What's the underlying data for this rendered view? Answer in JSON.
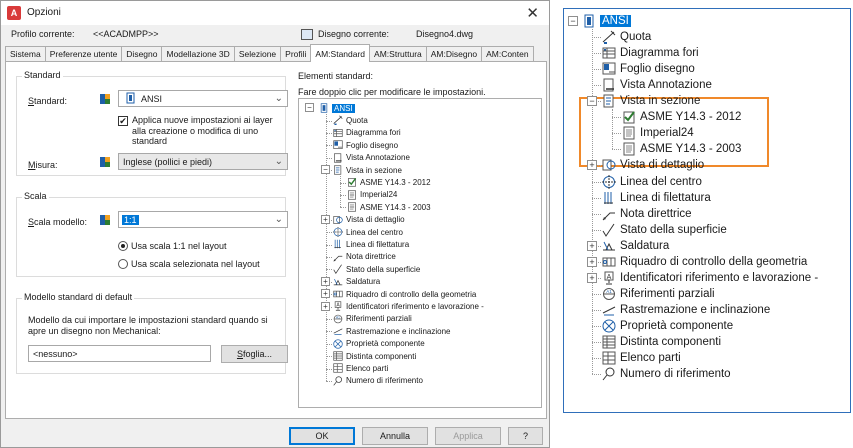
{
  "window": {
    "title": "Opzioni",
    "close_glyph": "✕"
  },
  "profile": {
    "current_label": "Profilo corrente:",
    "current_value": "<<ACADMPP>>",
    "drawing_label": "Disegno corrente:",
    "drawing_value": "Disegno4.dwg"
  },
  "tabs": [
    "Sistema",
    "Preferenze utente",
    "Disegno",
    "Modellazione 3D",
    "Selezione",
    "Profili",
    "AM:Standard",
    "AM:Struttura",
    "AM:Disegno",
    "AM:Conten"
  ],
  "active_tab": "AM:Standard",
  "standard_group": {
    "title": "Standard",
    "standard_label": "Standard:",
    "standard_value": "ANSI",
    "apply_checkbox_label": "Applica nuove impostazioni ai layer alla creazione o modifica di uno standard",
    "apply_checked": true,
    "units_label": "Misura:",
    "units_value": "Inglese (pollici e piedi)"
  },
  "scale_group": {
    "title": "Scala",
    "model_scale_label": "Scala modello:",
    "model_scale_value": "1:1",
    "radio_layout": "Usa scala 1:1 nel layout",
    "radio_selected": "Usa scala selezionata nel layout",
    "radio_checked_index": 0
  },
  "default_group": {
    "title": "Modello standard di default",
    "description": "Modello da cui importare le impostazioni standard quando si apre un disegno non Mechanical:",
    "value": "<nessuno>",
    "browse_label": "Sfoglia..."
  },
  "elements": {
    "title": "Elementi standard:",
    "hint": "Fare doppio clic per modificare le impostazioni.",
    "root": "ANSI",
    "items": [
      {
        "label": "Quota",
        "icon": "dimension-icon",
        "level": 1,
        "expander": null
      },
      {
        "label": "Diagramma fori",
        "icon": "hole-chart-icon",
        "level": 1,
        "expander": null
      },
      {
        "label": "Foglio disegno",
        "icon": "drawing-sheet-icon",
        "level": 1,
        "expander": null
      },
      {
        "label": "Vista Annotazione",
        "icon": "annotation-view-icon",
        "level": 1,
        "expander": null
      },
      {
        "label": "Vista in sezione",
        "icon": "section-view-icon",
        "level": 1,
        "expander": "-"
      },
      {
        "label": "ASME Y14.3 - 2012",
        "icon": "style-checked-icon",
        "level": 2,
        "expander": null
      },
      {
        "label": "Imperial24",
        "icon": "style-doc-icon",
        "level": 2,
        "expander": null
      },
      {
        "label": "ASME Y14.3 - 2003",
        "icon": "style-doc-icon",
        "level": 2,
        "expander": null
      },
      {
        "label": "Vista di dettaglio",
        "icon": "detail-view-icon",
        "level": 1,
        "expander": "+"
      },
      {
        "label": "Linea del centro",
        "icon": "centerline-icon",
        "level": 1,
        "expander": null
      },
      {
        "label": "Linea di filettatura",
        "icon": "thread-line-icon",
        "level": 1,
        "expander": null
      },
      {
        "label": "Nota direttrice",
        "icon": "leader-note-icon",
        "level": 1,
        "expander": null
      },
      {
        "label": "Stato della superficie",
        "icon": "surface-texture-icon",
        "level": 1,
        "expander": null
      },
      {
        "label": "Saldatura",
        "icon": "weld-icon",
        "level": 1,
        "expander": "+"
      },
      {
        "label": "Riquadro di controllo della geometria",
        "icon": "feature-control-frame-icon",
        "level": 1,
        "expander": "+"
      },
      {
        "label": "Identificatori riferimento e lavorazione -",
        "icon": "datum-identifier-icon",
        "level": 1,
        "expander": "+"
      },
      {
        "label": "Riferimenti parziali",
        "icon": "datum-target-icon",
        "level": 1,
        "expander": null
      },
      {
        "label": "Rastremazione e inclinazione",
        "icon": "taper-slope-icon",
        "level": 1,
        "expander": null
      },
      {
        "label": "Proprietà componente",
        "icon": "component-properties-icon",
        "level": 1,
        "expander": null
      },
      {
        "label": "Distinta componenti",
        "icon": "bom-icon",
        "level": 1,
        "expander": null
      },
      {
        "label": "Elenco parti",
        "icon": "parts-list-icon",
        "level": 1,
        "expander": null
      },
      {
        "label": "Numero di riferimento",
        "icon": "balloon-icon",
        "level": 1,
        "expander": null
      }
    ]
  },
  "buttons": {
    "ok": "OK",
    "cancel": "Annulla",
    "apply": "Applica",
    "help": "?"
  },
  "colors": {
    "accent": "#0078d7",
    "highlight": "#f0892a",
    "panel_border": "#2f6fba"
  }
}
